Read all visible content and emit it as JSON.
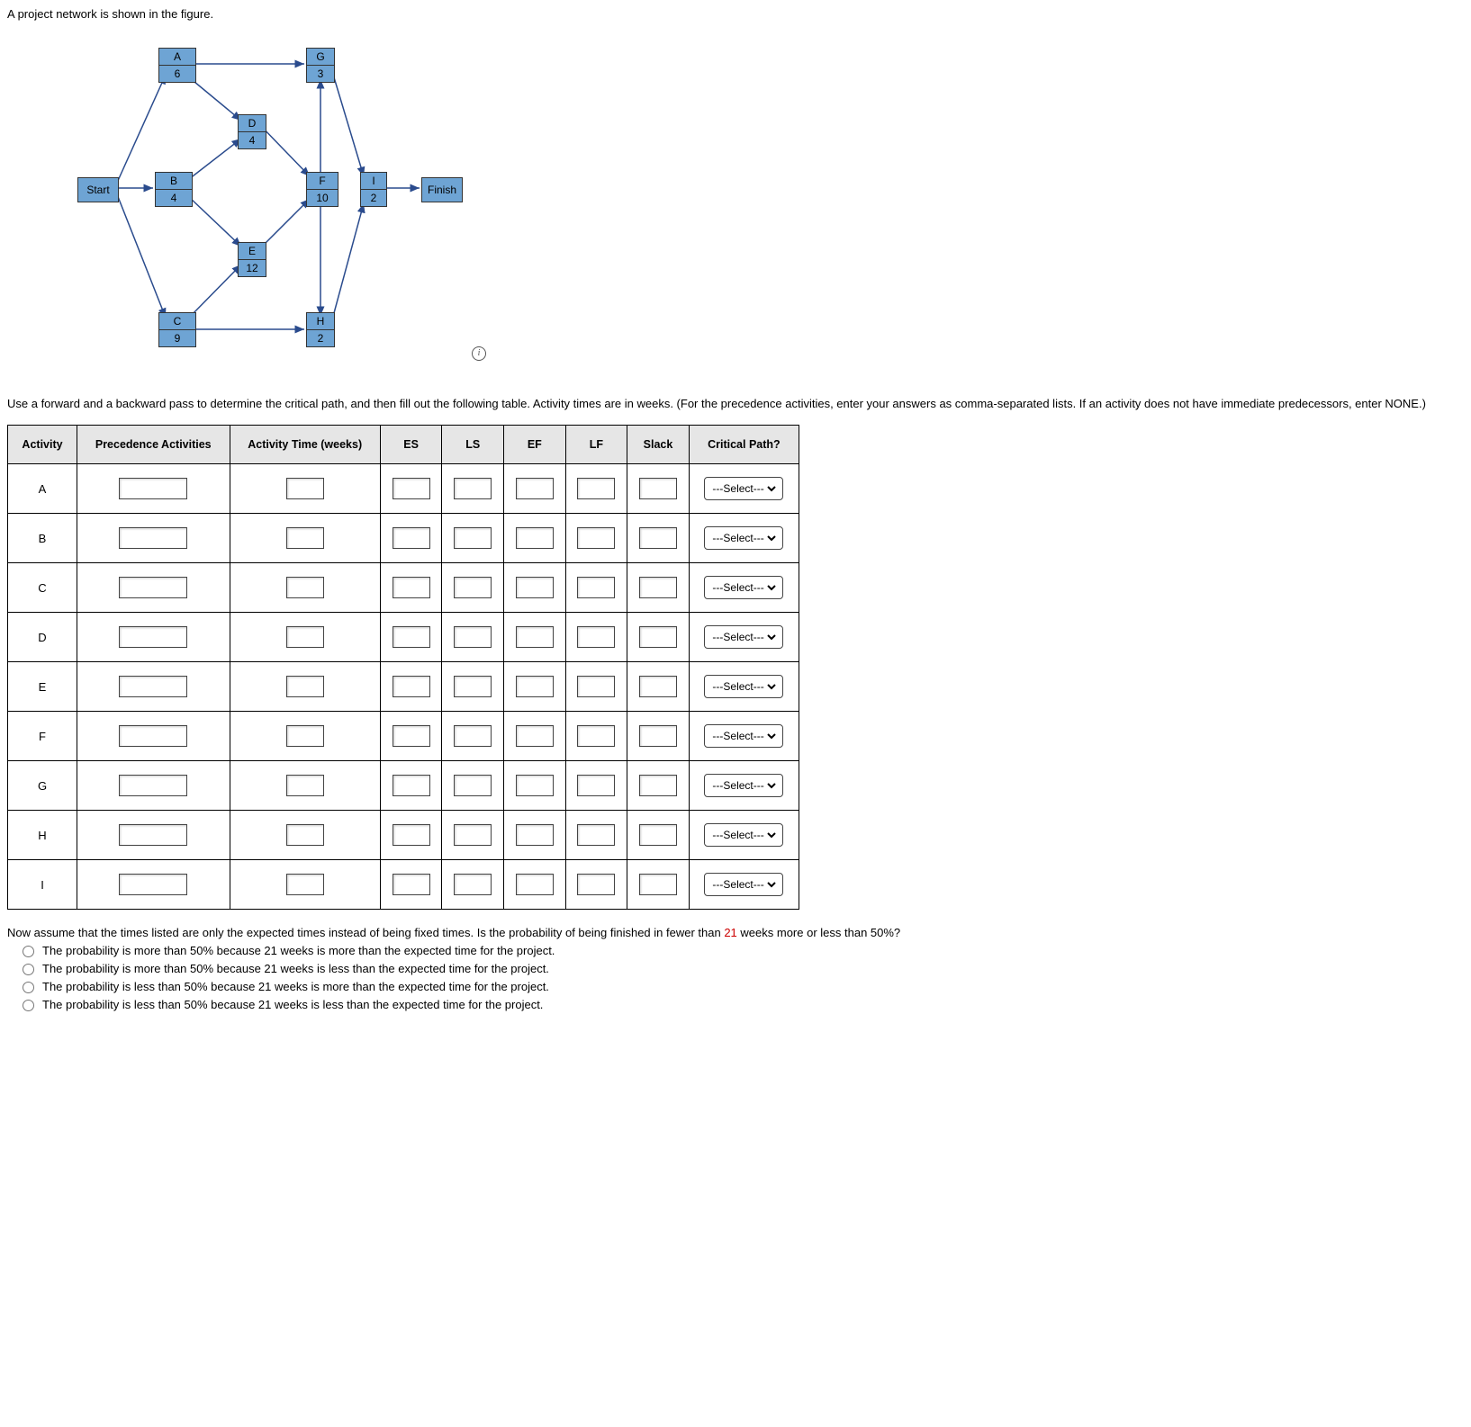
{
  "intro": "A project network is shown in the figure.",
  "instructions": "Use a forward and a backward pass to determine the critical path, and then fill out the following table. Activity times are in weeks. (For the precedence activities, enter your answers as comma-separated lists. If an activity does not have immediate predecessors, enter NONE.)",
  "diagram": {
    "start": "Start",
    "finish": "Finish",
    "nodes": {
      "A": {
        "label": "A",
        "val": "6"
      },
      "B": {
        "label": "B",
        "val": "4"
      },
      "C": {
        "label": "C",
        "val": "9"
      },
      "D": {
        "label": "D",
        "val": "4"
      },
      "E": {
        "label": "E",
        "val": "12"
      },
      "F": {
        "label": "F",
        "val": "10"
      },
      "G": {
        "label": "G",
        "val": "3"
      },
      "H": {
        "label": "H",
        "val": "2"
      },
      "I": {
        "label": "I",
        "val": "2"
      }
    }
  },
  "table": {
    "headers": {
      "activity": "Activity",
      "precedence": "Precedence Activities",
      "time": "Activity Time (weeks)",
      "es": "ES",
      "ls": "LS",
      "ef": "EF",
      "lf": "LF",
      "slack": "Slack",
      "crit": "Critical Path?"
    },
    "select_placeholder": "---Select---",
    "rows": [
      {
        "act": "A"
      },
      {
        "act": "B"
      },
      {
        "act": "C"
      },
      {
        "act": "D"
      },
      {
        "act": "E"
      },
      {
        "act": "F"
      },
      {
        "act": "G"
      },
      {
        "act": "H"
      },
      {
        "act": "I"
      }
    ]
  },
  "q2": {
    "prompt_before": "Now assume that the times listed are only the expected times instead of being fixed times. Is the probability of being finished in fewer than ",
    "prompt_num": "21",
    "prompt_after": " weeks more or less than 50%?",
    "options": [
      "The probability is more than 50% because 21 weeks is more than the expected time for the project.",
      "The probability is more than 50% because 21 weeks is less than the expected time for the project.",
      "The probability is less than 50% because 21 weeks is more than the expected time for the project.",
      "The probability is less than 50% because 21 weeks is less than the expected time for the project."
    ]
  }
}
